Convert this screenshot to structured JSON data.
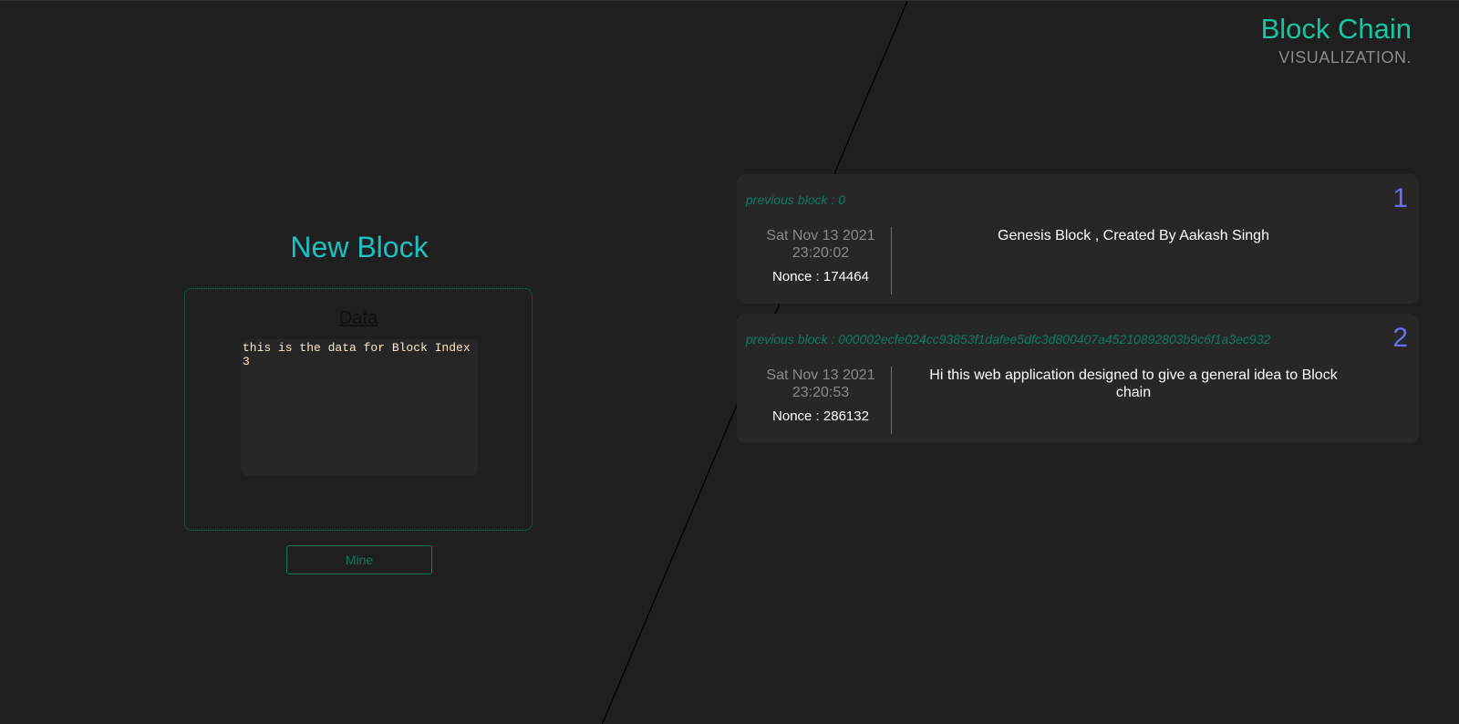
{
  "brand": {
    "title": "Block Chain",
    "subtitle": "VISUALIZATION."
  },
  "new_block": {
    "title": "New Block",
    "data_label": "Data",
    "data_value": "this is the data for Block Index\n3",
    "mine_label": "Mine"
  },
  "blocks": [
    {
      "previous": "previous block : 0",
      "index": "1",
      "date": "Sat Nov 13 2021",
      "time": "23:20:02",
      "nonce": "Nonce : 174464",
      "data": "Genesis Block , Created By Aakash Singh"
    },
    {
      "previous": "previous block : 000002ecfe024cc93853f1dafee5dfc3d800407a45210892803b9c6f1a3ec932",
      "index": "2",
      "date": "Sat Nov 13 2021",
      "time": "23:20:53",
      "nonce": "Nonce : 286132",
      "data": "Hi this web application designed to give a general idea to Block chain"
    }
  ],
  "colors": {
    "accent_green": "#12c7a2",
    "accent_cyan": "#19c2c2",
    "index_purple": "#6a6ff0",
    "background": "#1f1f1f"
  }
}
